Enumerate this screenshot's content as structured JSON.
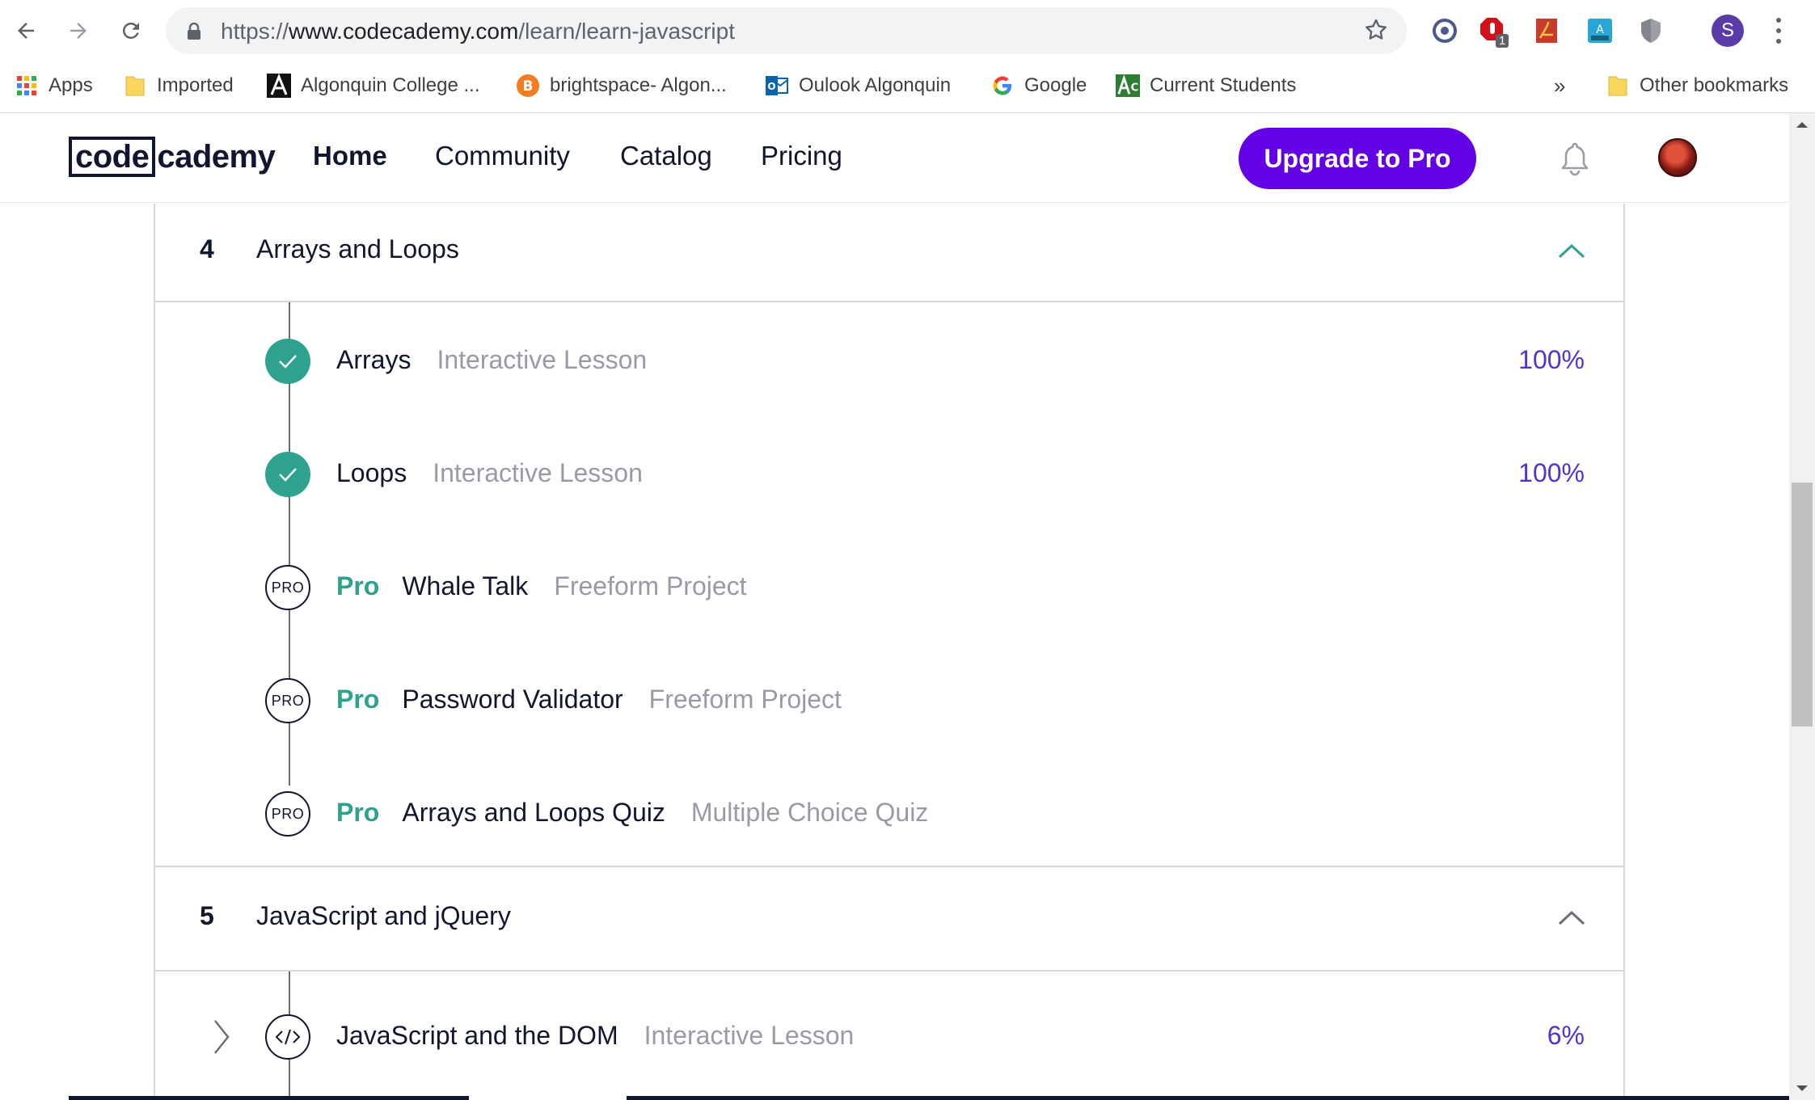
{
  "browser": {
    "url_prefix": "https://",
    "url_host": "www.codecademy.com",
    "url_path": "/learn/learn-javascript",
    "extension_badge": "1",
    "profile_initial": "S",
    "bookmarks": [
      {
        "label": "Apps",
        "icon": "apps-grid-icon"
      },
      {
        "label": "Imported",
        "icon": "folder-icon"
      },
      {
        "label": "Algonquin College ...",
        "icon": "algonquin-icon"
      },
      {
        "label": "brightspace- Algon...",
        "icon": "brightspace-icon"
      },
      {
        "label": "Oulook Algonquin",
        "icon": "outlook-icon"
      },
      {
        "label": "Google",
        "icon": "google-icon"
      },
      {
        "label": "Current Students",
        "icon": "current-students-icon"
      }
    ],
    "overflow_label": "»",
    "other_bookmarks": "Other bookmarks"
  },
  "header": {
    "logo_box": "code",
    "logo_rest": "cademy",
    "nav": [
      {
        "label": "Home",
        "active": true
      },
      {
        "label": "Community",
        "active": false
      },
      {
        "label": "Catalog",
        "active": false
      },
      {
        "label": "Pricing",
        "active": false
      }
    ],
    "upgrade_label": "Upgrade to Pro"
  },
  "syllabus": {
    "modules": [
      {
        "number": "4",
        "title": "Arrays and Loops",
        "expanded": true,
        "items": [
          {
            "status": "complete",
            "pro_label": "",
            "name": "Arrays",
            "type": "Interactive Lesson",
            "progress": "100%"
          },
          {
            "status": "complete",
            "pro_label": "",
            "name": "Loops",
            "type": "Interactive Lesson",
            "progress": "100%"
          },
          {
            "status": "pro",
            "node_label": "PRO",
            "pro_label": "Pro",
            "name": "Whale Talk",
            "type": "Freeform Project",
            "progress": ""
          },
          {
            "status": "pro",
            "node_label": "PRO",
            "pro_label": "Pro",
            "name": "Password Validator",
            "type": "Freeform Project",
            "progress": ""
          },
          {
            "status": "pro",
            "node_label": "PRO",
            "pro_label": "Pro",
            "name": "Arrays and Loops Quiz",
            "type": "Multiple Choice Quiz",
            "progress": ""
          }
        ]
      },
      {
        "number": "5",
        "title": "JavaScript and jQuery",
        "expanded": true,
        "items": [
          {
            "status": "in-progress",
            "pro_label": "",
            "name": "JavaScript and the DOM",
            "type": "Interactive Lesson",
            "progress": "6%"
          }
        ]
      }
    ]
  },
  "colors": {
    "accent_purple": "#6400e4",
    "complete_teal": "#2ea18f",
    "progress_purple": "#4b35d4"
  }
}
